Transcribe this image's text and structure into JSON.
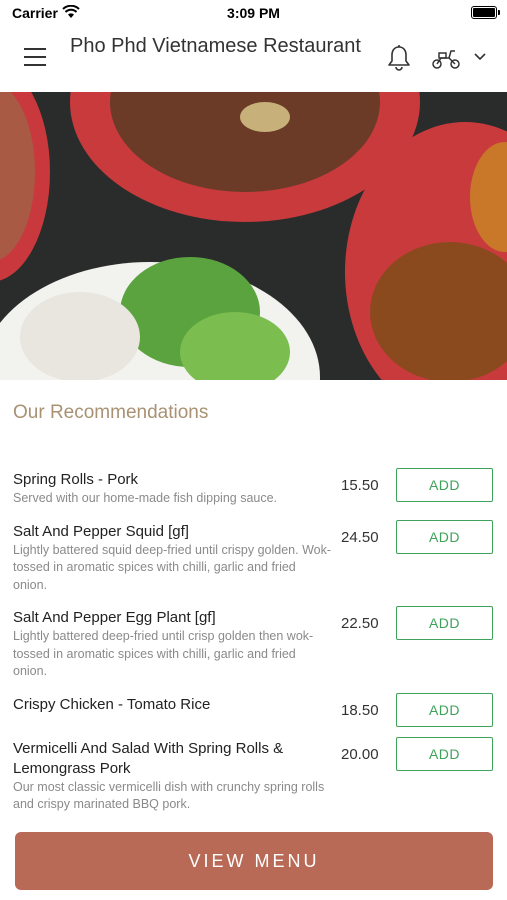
{
  "status": {
    "carrier": "Carrier",
    "time": "3:09 PM"
  },
  "header": {
    "title": "Pho Phd Vietnamese Restaurant"
  },
  "section_title": "Our Recommendations",
  "items": [
    {
      "name": "Spring Rolls - Pork",
      "desc": "Served with our home-made fish dipping sauce.",
      "price": "15.50",
      "add": "ADD"
    },
    {
      "name": "Salt And Pepper Squid [gf]",
      "desc": "Lightly battered squid deep-fried until crispy golden. Wok-tossed in aromatic spices with chilli, garlic and fried onion.",
      "price": "24.50",
      "add": "ADD"
    },
    {
      "name": "Salt And Pepper Egg Plant [gf]",
      "desc": "Lightly battered deep-fried until crisp golden then wok-tossed in aromatic spices with chilli, garlic and fried onion.",
      "price": "22.50",
      "add": "ADD"
    },
    {
      "name": "Crispy Chicken - Tomato Rice",
      "desc": "",
      "price": "18.50",
      "add": "ADD"
    },
    {
      "name": "Vermicelli And Salad With Spring Rolls & Lemongrass Pork",
      "desc": "Our most classic vermicelli dish with crunchy spring rolls and crispy marinated BBQ pork.",
      "price": "20.00",
      "add": "ADD"
    }
  ],
  "view_menu": "VIEW MENU",
  "colors": {
    "accent": "#3fa25a",
    "brand": "#b96a57",
    "section": "#a89273"
  },
  "icons": [
    "wifi-icon",
    "battery-icon",
    "menu-icon",
    "bell-icon",
    "scooter-icon",
    "chevron-down-icon"
  ]
}
